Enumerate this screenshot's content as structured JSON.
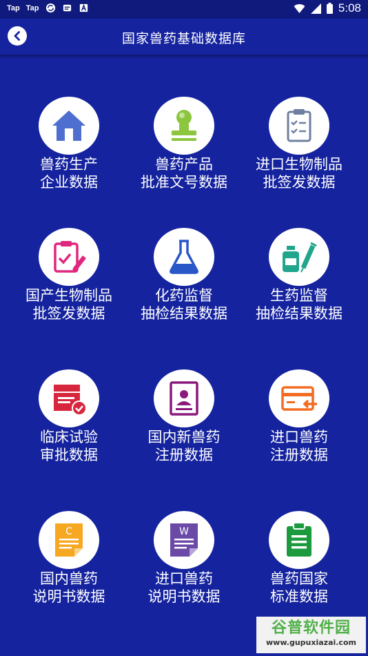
{
  "status_bar": {
    "apps": [
      "Tap",
      "Tap"
    ],
    "time": "5:08"
  },
  "header": {
    "title": "国家兽药基础数据库"
  },
  "tiles": [
    {
      "line1": "兽药生产",
      "line2": "企业数据",
      "icon": "house-icon",
      "color": "#4f6fd0"
    },
    {
      "line1": "兽药产品",
      "line2": "批准文号数据",
      "icon": "stamp-icon",
      "color": "#8cc63f"
    },
    {
      "line1": "进口生物制品",
      "line2": "批签发数据",
      "icon": "checklist-icon",
      "color": "#6f7fa0"
    },
    {
      "line1": "国产生物制品",
      "line2": "批签发数据",
      "icon": "clipboard-pen-icon",
      "color": "#e0267e"
    },
    {
      "line1": "化药监督",
      "line2": "抽检结果数据",
      "icon": "flask-icon",
      "color": "#2a57c8"
    },
    {
      "line1": "生药监督",
      "line2": "抽检结果数据",
      "icon": "vial-syringe-icon",
      "color": "#21a68d"
    },
    {
      "line1": "临床试验",
      "line2": "审批数据",
      "icon": "approval-box-icon",
      "color": "#d7263d"
    },
    {
      "line1": "国内新兽药",
      "line2": "注册数据",
      "icon": "id-card-icon",
      "color": "#8a1a7c"
    },
    {
      "line1": "进口兽药",
      "line2": "注册数据",
      "icon": "card-arrow-icon",
      "color": "#f36b21"
    },
    {
      "line1": "国内兽药",
      "line2": "说明书数据",
      "icon": "document-c-icon",
      "color": "#f7a823"
    },
    {
      "line1": "进口兽药",
      "line2": "说明书数据",
      "icon": "document-w-icon",
      "color": "#6a4aa6"
    },
    {
      "line1": "兽药国家",
      "line2": "标准数据",
      "icon": "green-clipboard-icon",
      "color": "#1c9a3e"
    }
  ],
  "watermark": {
    "brand": "谷普软件园",
    "url": "www.gupuxiazai.com"
  }
}
